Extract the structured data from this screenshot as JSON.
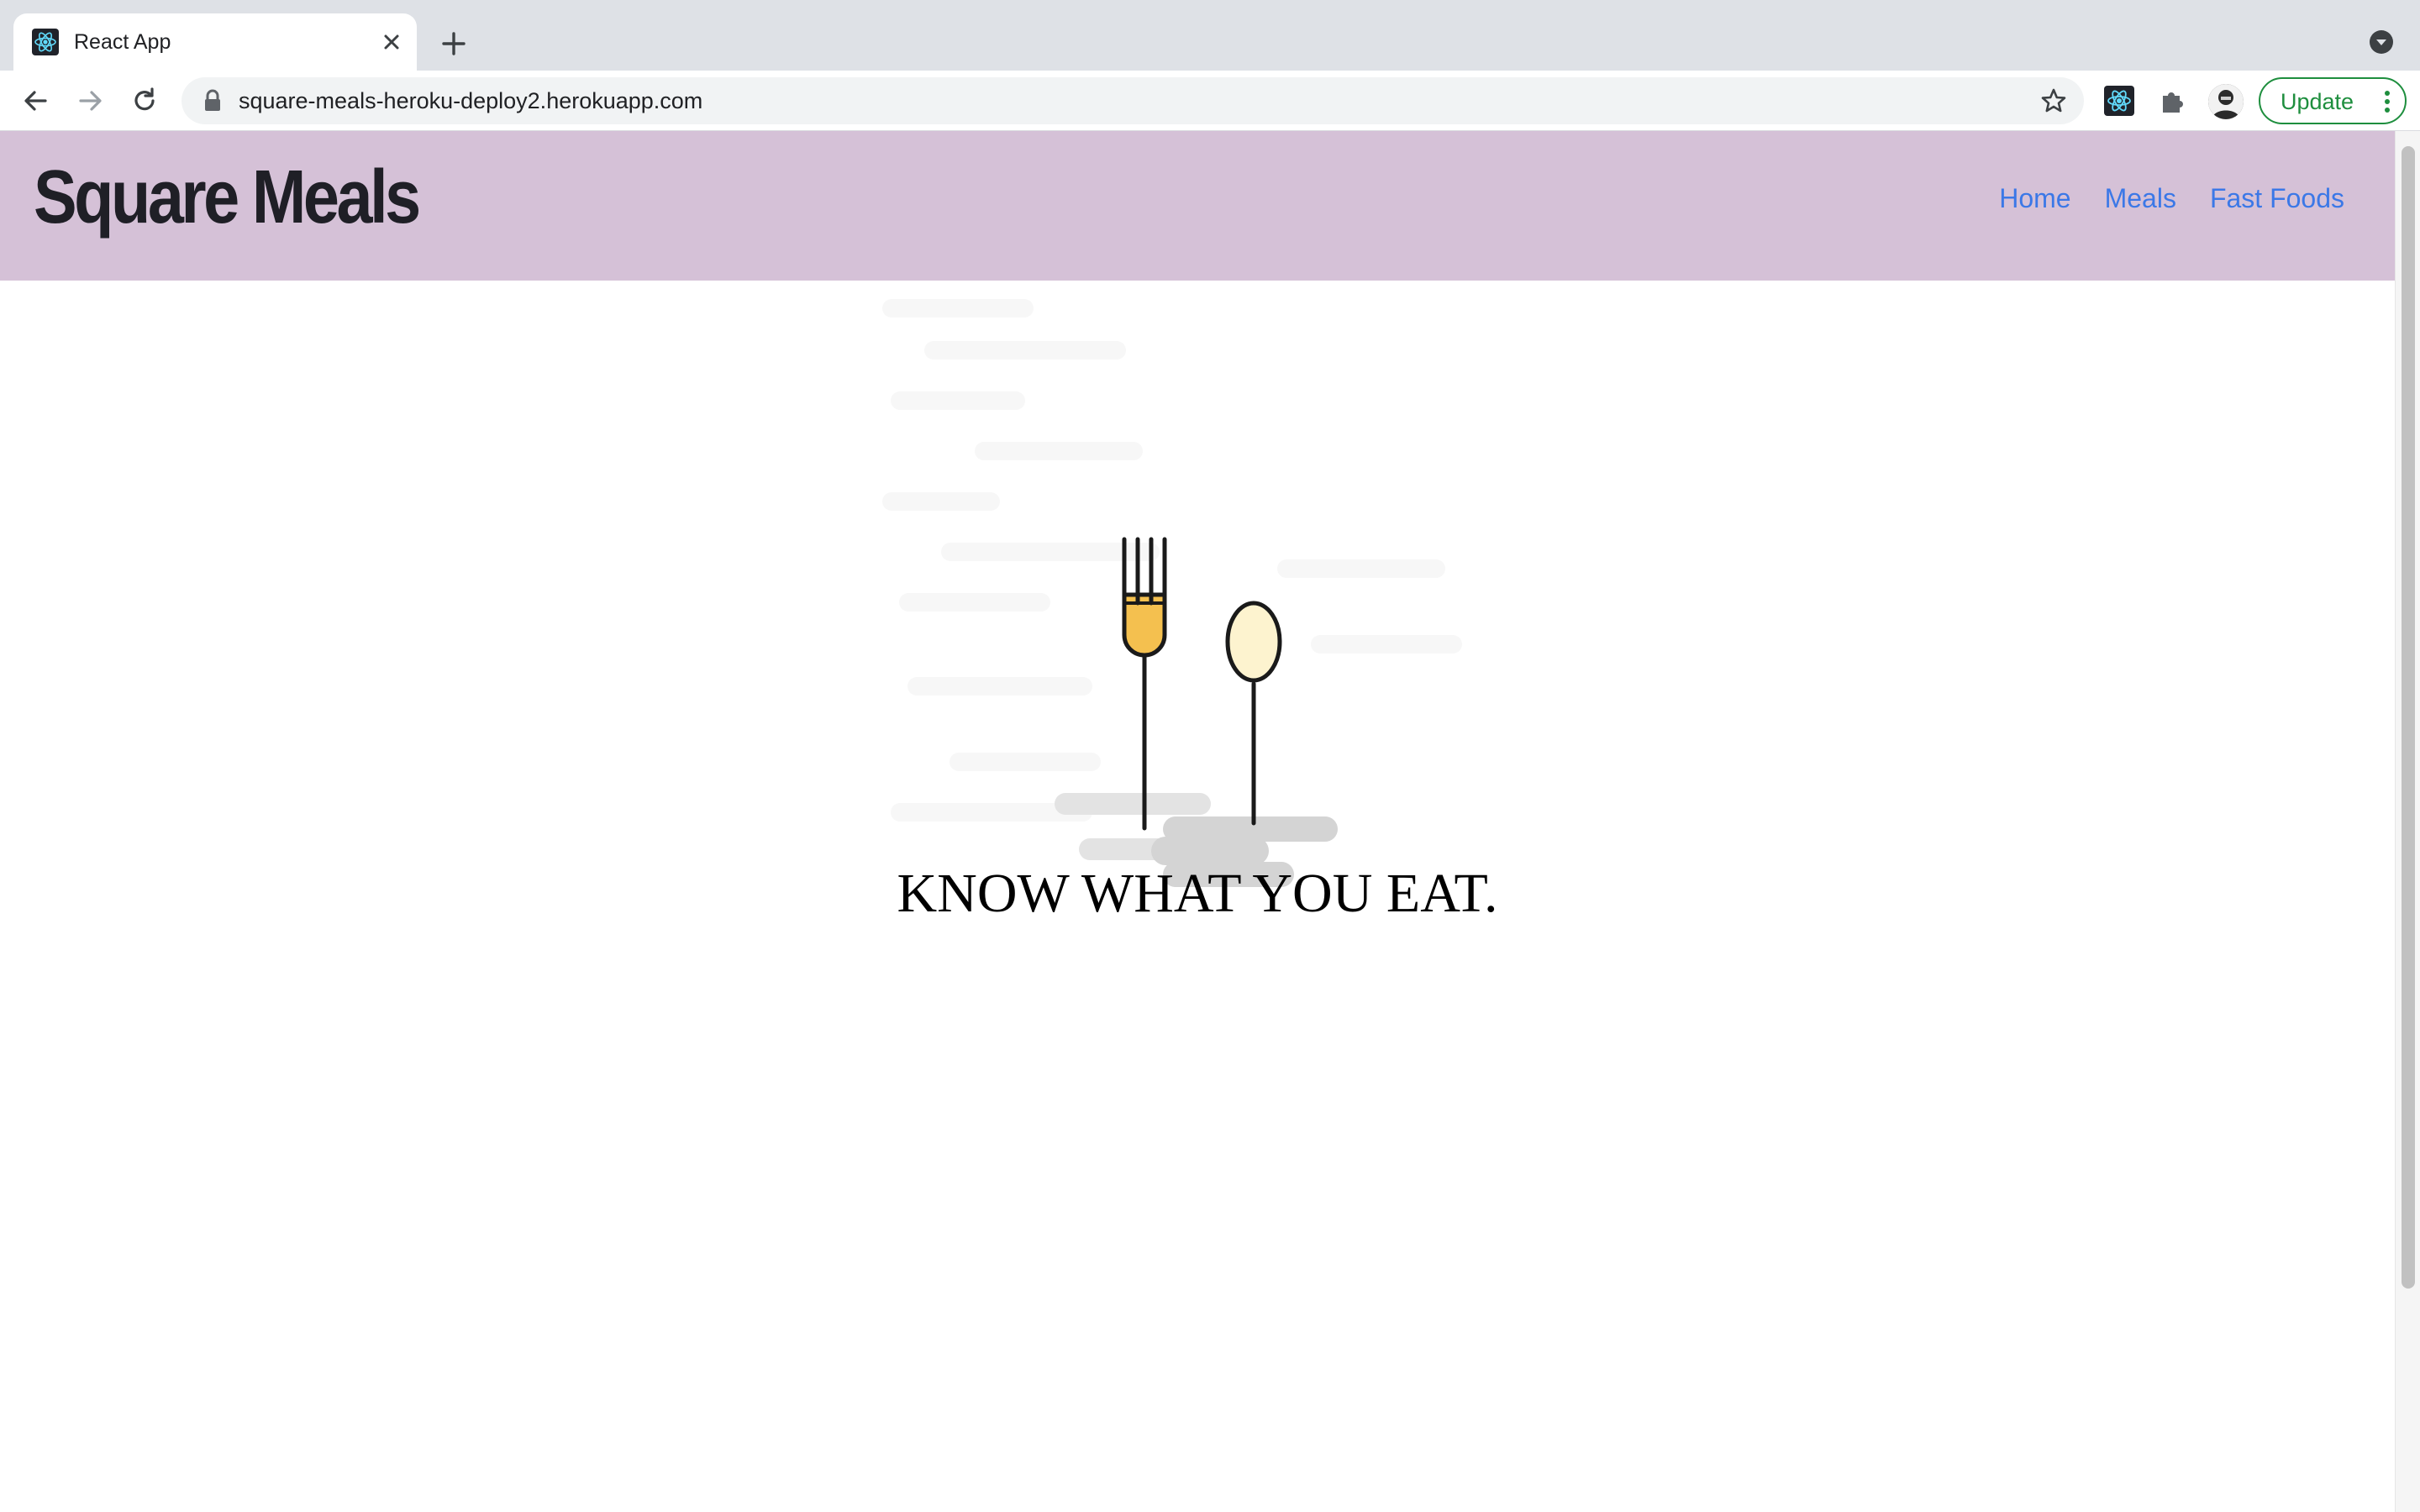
{
  "browser": {
    "tab": {
      "title": "React App",
      "favicon": "react-logo-icon"
    },
    "url": "square-meals-heroku-deploy2.herokuapp.com",
    "update_label": "Update",
    "icons": {
      "back": "arrow-left-icon",
      "forward": "arrow-right-icon",
      "reload": "reload-icon",
      "lock": "lock-icon",
      "bookmark": "star-icon",
      "extension_react": "react-devtools-icon",
      "extensions": "puzzle-icon",
      "profile": "avatar",
      "menu": "more-vert-icon",
      "new_tab": "plus-icon",
      "tab_search": "chevron-down-icon"
    },
    "colors": {
      "update_green": "#1e8e3e",
      "chrome_gray": "#dee1e6"
    }
  },
  "page": {
    "brand": "Square Meals",
    "nav": [
      {
        "label": "Home"
      },
      {
        "label": "Meals"
      },
      {
        "label": "Fast Foods"
      }
    ],
    "tagline": "KNOW WHAT YOU EAT.",
    "illustration": "fork-and-spoon-illustration",
    "colors": {
      "header_bg": "#d5c1d7",
      "nav_link": "#3b78e7",
      "fork_fill": "#f4c04f",
      "spoon_fill": "#fdf3cf"
    }
  }
}
